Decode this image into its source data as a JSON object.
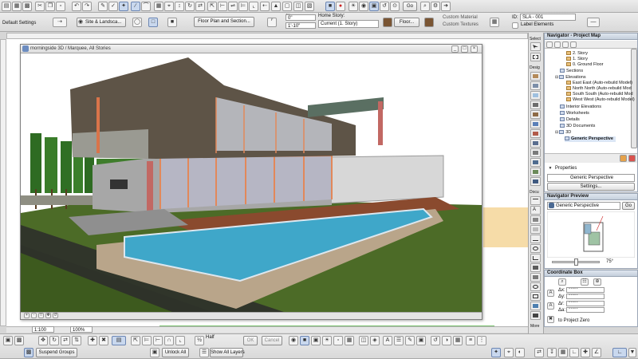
{
  "toolbar_top": {
    "default_settings": "Default Settings",
    "site_landscape": "Site & Landsca...",
    "floor_plan_section": "Floor Plan and Section...",
    "offset_values": [
      "0\"",
      "1'-10\"",
      "0\""
    ],
    "home_story_label": "Home Story:",
    "home_story_value": "Current (1. Story)",
    "floor_label": "Floor...",
    "custom_material": "Custom Material",
    "custom_textures": "Custom Textures",
    "id_label": "ID:",
    "id_value": "SLA - 001",
    "label_elements": "Label Elements",
    "go_label": "Go"
  },
  "viewport": {
    "title": "morningside 3D / Marquee, All Stories",
    "status_scale": "1:100",
    "status_zoom": "100%"
  },
  "toolbox": {
    "labels": [
      "Select",
      "Desig",
      "Docu",
      "More"
    ]
  },
  "navigator": {
    "header": "Navigator - Project Map",
    "items": [
      {
        "label": "2. Story",
        "indent": 2,
        "kind": "f"
      },
      {
        "label": "1. Story",
        "indent": 2,
        "kind": "f"
      },
      {
        "label": "0. Ground Floor",
        "indent": 2,
        "kind": "f"
      },
      {
        "label": "Sections",
        "indent": 1,
        "kind": "v"
      },
      {
        "label": "Elevations",
        "indent": 1,
        "kind": "v"
      },
      {
        "label": "East East (Auto-rebuild Model)",
        "indent": 2,
        "kind": "f"
      },
      {
        "label": "North North (Auto-rebuild Mod",
        "indent": 2,
        "kind": "f"
      },
      {
        "label": "South South (Auto-rebuild Mod",
        "indent": 2,
        "kind": "f"
      },
      {
        "label": "West West (Auto-rebuild Model)",
        "indent": 2,
        "kind": "f"
      },
      {
        "label": "Interior Elevations",
        "indent": 1,
        "kind": "v"
      },
      {
        "label": "Worksheets",
        "indent": 1,
        "kind": "v"
      },
      {
        "label": "Details",
        "indent": 1,
        "kind": "v"
      },
      {
        "label": "3D Documents",
        "indent": 1,
        "kind": "v"
      },
      {
        "label": "3D",
        "indent": 1,
        "kind": "v"
      },
      {
        "label": "Generic Perspective",
        "indent": 2,
        "kind": "v"
      }
    ],
    "properties_label": "Properties",
    "properties_value": "Generic Perspective",
    "settings_button": "Settings..."
  },
  "preview": {
    "header": "Navigator Preview",
    "view_name": "Generic Perspective",
    "go_label": "Go",
    "angle": "75°"
  },
  "coord_box": {
    "header": "Coordinate Box",
    "rows": [
      {
        "key": "Δx:",
        "value": "*****"
      },
      {
        "key": "Δy:",
        "value": "*****"
      },
      {
        "key": "Δr:",
        "value": "*****"
      },
      {
        "key": "Δa:",
        "value": "*****"
      }
    ],
    "project_zero": "to Project Zero"
  },
  "bottom_toolbar": {
    "suspend_groups": "Suspend Groups",
    "unlock_all": "Unlock All",
    "half": "Half",
    "ok": "OK",
    "cancel": "Cancel",
    "show_all_layers": "Show All Layers"
  },
  "colors": {
    "pool_water": "#3fa7c9",
    "lawn": "#4f6f2a",
    "sky": "#ffffff",
    "accent_select": "#c9d8ee"
  }
}
